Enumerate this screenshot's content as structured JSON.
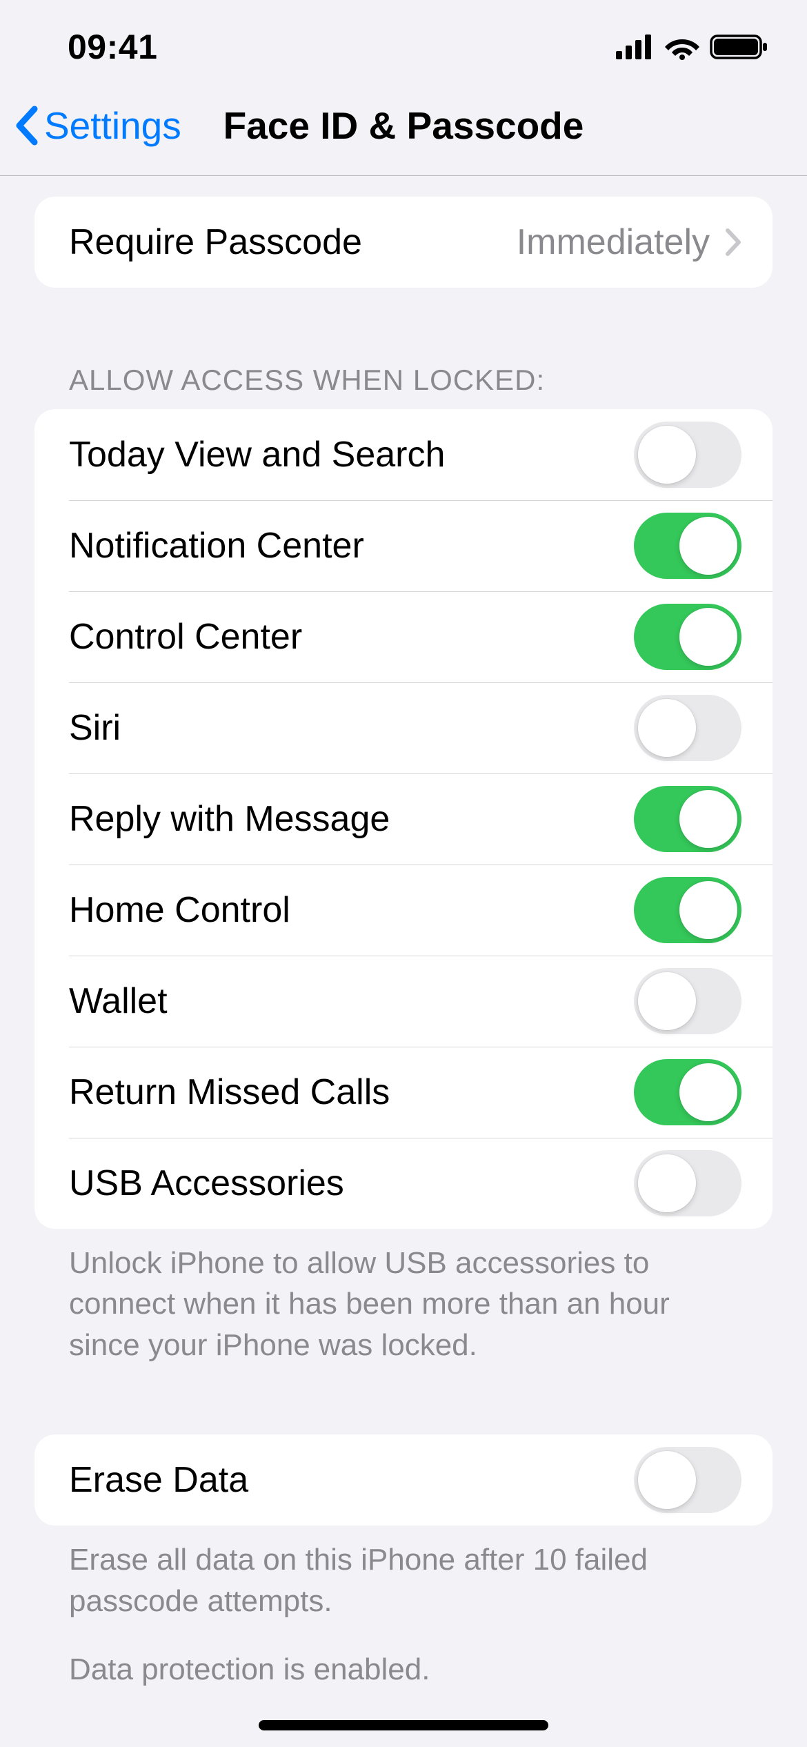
{
  "status": {
    "time": "09:41"
  },
  "nav": {
    "back_label": "Settings",
    "title": "Face ID & Passcode"
  },
  "require_passcode": {
    "label": "Require Passcode",
    "value": "Immediately"
  },
  "allow_access": {
    "header": "ALLOW ACCESS WHEN LOCKED:",
    "items": [
      {
        "label": "Today View and Search",
        "on": false
      },
      {
        "label": "Notification Center",
        "on": true
      },
      {
        "label": "Control Center",
        "on": true
      },
      {
        "label": "Siri",
        "on": false
      },
      {
        "label": "Reply with Message",
        "on": true
      },
      {
        "label": "Home Control",
        "on": true
      },
      {
        "label": "Wallet",
        "on": false
      },
      {
        "label": "Return Missed Calls",
        "on": true
      },
      {
        "label": "USB Accessories",
        "on": false
      }
    ],
    "footer": "Unlock iPhone to allow USB accessories to connect when it has been more than an hour since your iPhone was locked."
  },
  "erase": {
    "label": "Erase Data",
    "on": false,
    "footer1": "Erase all data on this iPhone after 10 failed passcode attempts.",
    "footer2": "Data protection is enabled."
  }
}
